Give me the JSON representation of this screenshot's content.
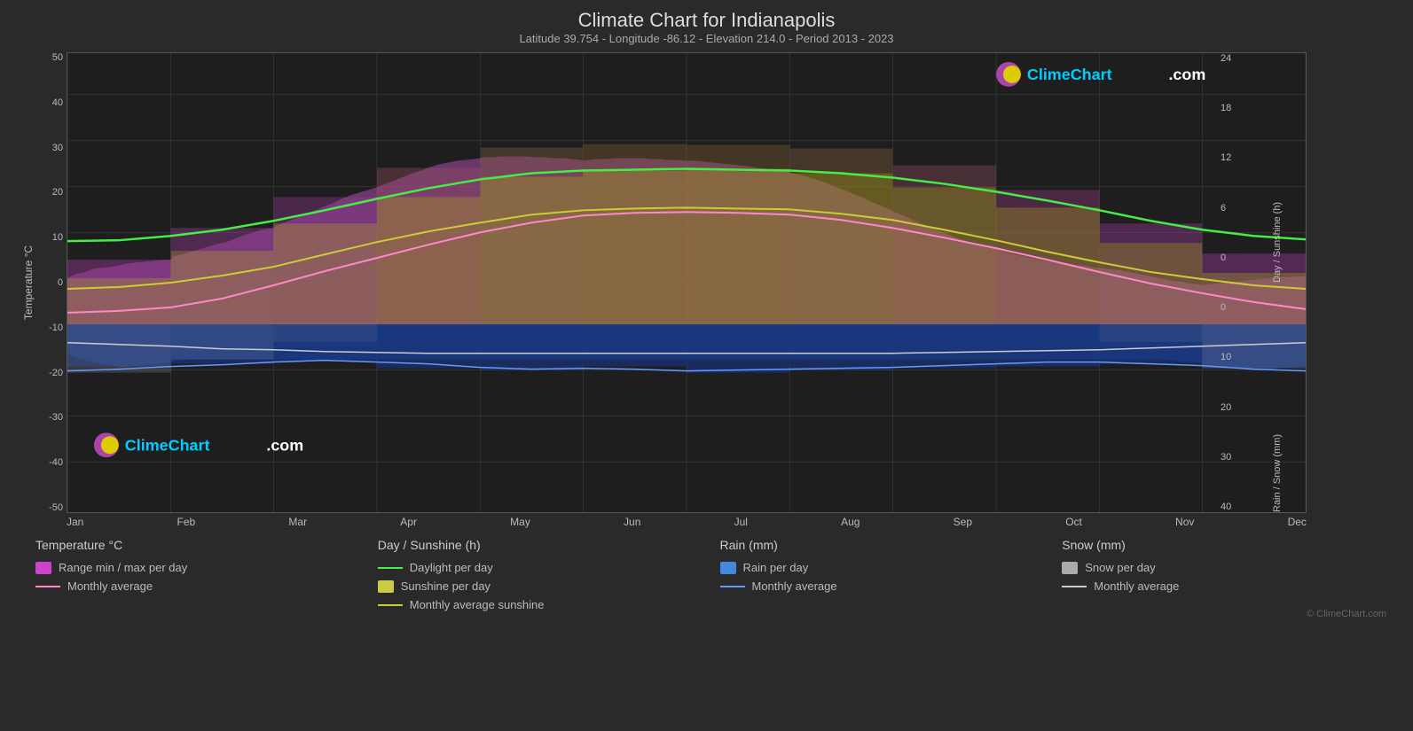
{
  "title": "Climate Chart for Indianapolis",
  "subtitle": "Latitude 39.754 - Longitude -86.12 - Elevation 214.0 - Period 2013 - 2023",
  "logo_text": "ClimeChart.com",
  "copyright": "© ClimeChart.com",
  "y_axis_left": {
    "label": "Temperature °C",
    "ticks": [
      "50",
      "40",
      "30",
      "20",
      "10",
      "0",
      "-10",
      "-20",
      "-30",
      "-40",
      "-50"
    ]
  },
  "y_axis_right_sunshine": {
    "label": "Day / Sunshine (h)",
    "ticks": [
      "24",
      "18",
      "12",
      "6",
      "0"
    ]
  },
  "y_axis_right_rain": {
    "label": "Rain / Snow (mm)",
    "ticks": [
      "0",
      "10",
      "20",
      "30",
      "40"
    ]
  },
  "x_axis": {
    "months": [
      "Jan",
      "Feb",
      "Mar",
      "Apr",
      "May",
      "Jun",
      "Jul",
      "Aug",
      "Sep",
      "Oct",
      "Nov",
      "Dec"
    ]
  },
  "legend": {
    "temperature": {
      "header": "Temperature °C",
      "items": [
        {
          "type": "swatch",
          "color": "#cc44cc",
          "label": "Range min / max per day"
        },
        {
          "type": "line",
          "color": "#ff99cc",
          "label": "Monthly average"
        }
      ]
    },
    "sunshine": {
      "header": "Day / Sunshine (h)",
      "items": [
        {
          "type": "line",
          "color": "#44dd44",
          "label": "Daylight per day"
        },
        {
          "type": "swatch",
          "color": "#ccdd44",
          "label": "Sunshine per day"
        },
        {
          "type": "line",
          "color": "#dddd44",
          "label": "Monthly average sunshine"
        }
      ]
    },
    "rain": {
      "header": "Rain (mm)",
      "items": [
        {
          "type": "swatch",
          "color": "#4488dd",
          "label": "Rain per day"
        },
        {
          "type": "line",
          "color": "#66aaff",
          "label": "Monthly average"
        }
      ]
    },
    "snow": {
      "header": "Snow (mm)",
      "items": [
        {
          "type": "swatch",
          "color": "#aaaaaa",
          "label": "Snow per day"
        },
        {
          "type": "line",
          "color": "#cccccc",
          "label": "Monthly average"
        }
      ]
    }
  }
}
